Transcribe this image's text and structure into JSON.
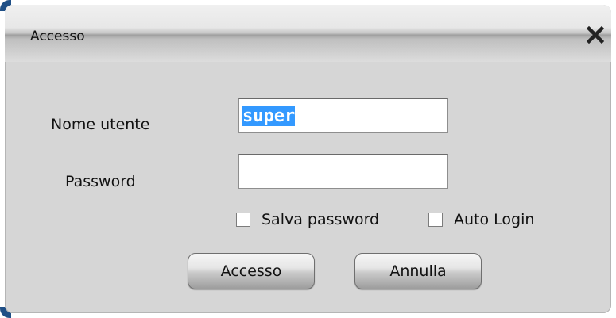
{
  "window": {
    "title": "Accesso",
    "close_glyph": "X"
  },
  "form": {
    "username_label": "Nome utente",
    "username_value": "super",
    "password_label": "Password",
    "password_value": "",
    "save_password_label": "Salva password",
    "save_password_checked": false,
    "auto_login_label": "Auto Login",
    "auto_login_checked": false
  },
  "buttons": {
    "login_label": "Accesso",
    "cancel_label": "Annulla"
  },
  "colors": {
    "dialog_background": "#d6d6d6",
    "selection_highlight": "#3399ff",
    "frame_corner": "#1f4f86"
  },
  "icons": {
    "close": "close-icon"
  }
}
